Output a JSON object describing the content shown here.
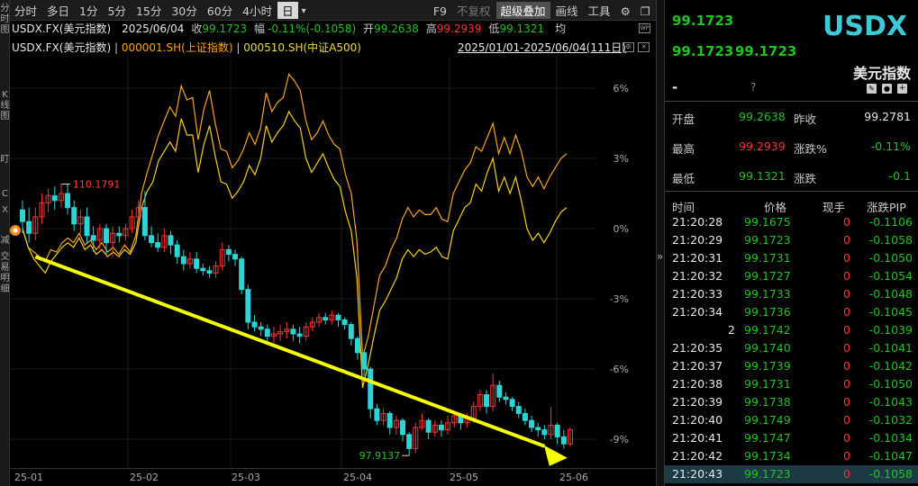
{
  "left_tabs": [
    "分时图",
    "K线图",
    "盯",
    "C",
    "X",
    "减",
    "交易明细"
  ],
  "toolbar": {
    "periods": [
      "分时",
      "多日",
      "1分",
      "5分",
      "15分",
      "30分",
      "60分",
      "4小时",
      "日"
    ],
    "active_period": "日",
    "dropdown_symbol": "▾",
    "f9": "F9",
    "no_rights": "不复权",
    "super_overlay": "超级叠加",
    "draw_line": "画线",
    "tools": "工具",
    "settings_icon": "gear-icon",
    "window_icons": [
      "restore-icon",
      "close-icon"
    ]
  },
  "info": {
    "symbol": "USDX.FX(美元指数)",
    "date": "2025/06/04",
    "close_label": "收",
    "close": "99.1723",
    "amp_label": "幅",
    "amp": "-0.11%(-0.1058)",
    "open_label": "开",
    "open": "99.2638",
    "high_label": "高",
    "high": "99.2939",
    "low_label": "低",
    "low": "99.1321",
    "avg_label": "均"
  },
  "legend": {
    "main": "USDX.FX(美元指数)",
    "sep": "|",
    "overlay1": "000001.SH(上证指数)",
    "overlay2": "000510.SH(中证A500)",
    "range": "2025/01/01-2025/06/04(111日)",
    "icons": [
      "settings-icon",
      "close-icon"
    ]
  },
  "chart_data": {
    "type": "candlestick",
    "y_axis_ticks": [
      "6%",
      "3%",
      "0%",
      "-3%",
      "-6%",
      "-9%"
    ],
    "y_axis_values": [
      6,
      3,
      0,
      -3,
      -6,
      -9
    ],
    "x_axis_ticks": [
      "25-01",
      "25-02",
      "25-03",
      "25-04",
      "25-05",
      "25-06"
    ],
    "annotations": {
      "high": "110.1791",
      "low": "97.9137"
    },
    "colors": {
      "up": "#ff3333",
      "down": "#2dd4d4",
      "overlay1": "#f5a623",
      "overlay2": "#f5d020",
      "arrow": "#f5ff00"
    },
    "candles": [
      [
        0.8,
        0.3,
        1.2,
        -0.2
      ],
      [
        0.3,
        -0.2,
        0.9,
        -0.6
      ],
      [
        -0.2,
        0.5,
        0.9,
        -0.5
      ],
      [
        0.5,
        1.1,
        1.5,
        0.2
      ],
      [
        1.1,
        1.4,
        1.7,
        0.7
      ],
      [
        1.4,
        1.2,
        1.8,
        0.8
      ],
      [
        1.2,
        1.5,
        1.9,
        0.9
      ],
      [
        1.5,
        0.9,
        1.9,
        0.6
      ],
      [
        0.9,
        0.2,
        1.2,
        -0.1
      ],
      [
        0.2,
        0.5,
        0.8,
        -0.2
      ],
      [
        0.5,
        -0.3,
        0.9,
        -0.6
      ],
      [
        -0.3,
        -0.5,
        0.1,
        -1.0
      ],
      [
        -0.5,
        0.0,
        0.2,
        -0.9
      ],
      [
        0.0,
        -0.6,
        0.2,
        -1.1
      ],
      [
        -0.6,
        -0.2,
        0.1,
        -1.2
      ],
      [
        -0.2,
        -0.3,
        0.1,
        -0.6
      ],
      [
        -0.3,
        0.0,
        0.2,
        -0.5
      ],
      [
        0.0,
        0.5,
        0.8,
        -0.2
      ],
      [
        0.5,
        0.9,
        1.2,
        0.3
      ],
      [
        0.9,
        -0.3,
        1.6,
        -0.5
      ],
      [
        -0.3,
        -0.6,
        0.1,
        -0.8
      ],
      [
        -0.6,
        -0.8,
        -0.2,
        -1.0
      ],
      [
        -0.8,
        -0.3,
        0.0,
        -1.0
      ],
      [
        -0.3,
        -0.7,
        -0.1,
        -1.1
      ],
      [
        -0.7,
        -1.2,
        -0.5,
        -1.5
      ],
      [
        -1.2,
        -1.5,
        -0.9,
        -1.8
      ],
      [
        -1.5,
        -1.3,
        -1.0,
        -1.7
      ],
      [
        -1.3,
        -1.7,
        -1.0,
        -1.9
      ],
      [
        -1.7,
        -1.8,
        -1.5,
        -2.0
      ],
      [
        -1.8,
        -1.9,
        -1.6,
        -2.1
      ],
      [
        -1.9,
        -1.6,
        -1.4,
        -2.1
      ],
      [
        -1.6,
        -0.9,
        -0.6,
        -1.8
      ],
      [
        -0.9,
        -1.1,
        -0.7,
        -1.4
      ],
      [
        -1.1,
        -1.3,
        -0.9,
        -1.6
      ],
      [
        -1.3,
        -2.6,
        -1.2,
        -2.8
      ],
      [
        -2.6,
        -4.0,
        -2.4,
        -4.3
      ],
      [
        -4.0,
        -4.2,
        -3.7,
        -4.4
      ],
      [
        -4.2,
        -4.3,
        -4.0,
        -4.6
      ],
      [
        -4.3,
        -4.6,
        -4.1,
        -4.8
      ],
      [
        -4.6,
        -4.5,
        -4.2,
        -4.9
      ],
      [
        -4.5,
        -4.4,
        -4.1,
        -4.8
      ],
      [
        -4.4,
        -4.3,
        -4.0,
        -4.7
      ],
      [
        -4.3,
        -4.5,
        -4.1,
        -4.8
      ],
      [
        -4.5,
        -4.6,
        -4.2,
        -4.9
      ],
      [
        -4.6,
        -4.2,
        -4.0,
        -4.8
      ],
      [
        -4.2,
        -4.0,
        -3.8,
        -4.4
      ],
      [
        -4.0,
        -3.8,
        -3.6,
        -4.2
      ],
      [
        -3.8,
        -3.9,
        -3.6,
        -4.1
      ],
      [
        -3.9,
        -3.7,
        -3.5,
        -4.1
      ],
      [
        -3.7,
        -3.9,
        -3.6,
        -4.2
      ],
      [
        -3.9,
        -4.1,
        -3.8,
        -4.3
      ],
      [
        -4.1,
        -4.7,
        -4.0,
        -5.0
      ],
      [
        -4.7,
        -5.3,
        -4.6,
        -5.6
      ],
      [
        -5.3,
        -6.0,
        -5.2,
        -6.3
      ],
      [
        -6.0,
        -7.7,
        -5.9,
        -8.1
      ],
      [
        -7.7,
        -8.2,
        -7.5,
        -8.4
      ],
      [
        -8.2,
        -7.9,
        -7.7,
        -8.4
      ],
      [
        -7.9,
        -8.5,
        -7.8,
        -8.8
      ],
      [
        -8.5,
        -8.2,
        -8.0,
        -8.8
      ],
      [
        -8.2,
        -8.8,
        -8.1,
        -9.1
      ],
      [
        -8.8,
        -9.4,
        -8.7,
        -9.7
      ],
      [
        -9.4,
        -8.5,
        -8.3,
        -9.6
      ],
      [
        -8.5,
        -8.2,
        -7.9,
        -8.6
      ],
      [
        -8.2,
        -8.7,
        -8.1,
        -9.0
      ],
      [
        -8.7,
        -8.4,
        -8.2,
        -8.9
      ],
      [
        -8.4,
        -8.6,
        -8.2,
        -8.9
      ],
      [
        -8.6,
        -8.3,
        -8.0,
        -8.8
      ],
      [
        -8.3,
        -8.0,
        -7.8,
        -8.5
      ],
      [
        -8.0,
        -8.3,
        -7.9,
        -8.6
      ],
      [
        -8.3,
        -8.1,
        -7.9,
        -8.5
      ],
      [
        -8.1,
        -7.6,
        -7.4,
        -8.3
      ],
      [
        -7.6,
        -7.1,
        -6.9,
        -7.8
      ],
      [
        -7.1,
        -7.6,
        -6.9,
        -7.9
      ],
      [
        -7.6,
        -6.7,
        -6.2,
        -7.8
      ],
      [
        -6.7,
        -7.2,
        -6.5,
        -7.4
      ],
      [
        -7.2,
        -7.3,
        -7.0,
        -7.5
      ],
      [
        -7.3,
        -7.6,
        -7.2,
        -7.8
      ],
      [
        -7.6,
        -7.9,
        -7.4,
        -8.1
      ],
      [
        -7.9,
        -8.2,
        -7.7,
        -8.4
      ],
      [
        -8.2,
        -8.5,
        -8.0,
        -8.7
      ],
      [
        -8.5,
        -8.6,
        -8.3,
        -8.9
      ],
      [
        -8.6,
        -8.8,
        -8.4,
        -9.0
      ],
      [
        -8.8,
        -8.4,
        -7.6,
        -9.0
      ],
      [
        -8.4,
        -8.9,
        -8.3,
        -9.2
      ],
      [
        -8.9,
        -9.2,
        -8.6,
        -9.4
      ],
      [
        -9.2,
        -8.6,
        -8.5,
        -9.3
      ]
    ],
    "overlay1_values": [
      0,
      -0.8,
      -1.0,
      -1.2,
      -1.4,
      -0.9,
      -1.0,
      -0.6,
      -0.4,
      -0.6,
      -0.2,
      -0.7,
      -0.5,
      -0.9,
      -0.6,
      -1.0,
      -0.8,
      -1.1,
      -0.7,
      -1.0,
      -0.3,
      1.5,
      2.4,
      3.2,
      4.0,
      4.6,
      5.2,
      4.8,
      6.1,
      5.5,
      5.6,
      3.8,
      5.1,
      5.9,
      4.5,
      3.4,
      3.3,
      2.6,
      2.9,
      3.4,
      4.1,
      3.6,
      4.3,
      5.8,
      5.0,
      5.4,
      5.6,
      6.6,
      6.3,
      5.9,
      4.6,
      3.8,
      4.1,
      4.6,
      4.0,
      3.6,
      3.4,
      2.3,
      1.5,
      -0.5,
      -5.5,
      -4.6,
      -3.3,
      -2.0,
      -1.6,
      -0.9,
      -0.4,
      0.4,
      0.9,
      0.5,
      0.8,
      0.6,
      0.6,
      0.9,
      0.4,
      0.3,
      1.5,
      2.0,
      2.5,
      2.8,
      3.5,
      3.3,
      3.9,
      4.5,
      3.2,
      3.9,
      3.2,
      4.0,
      3.3,
      2.2,
      1.8,
      2.2,
      1.7,
      2.2,
      2.6,
      3.0,
      3.2
    ],
    "overlay2_values": [
      0,
      -0.8,
      -1.3,
      -1.6,
      -1.9,
      -1.4,
      -1.1,
      -0.8,
      -0.6,
      -0.8,
      -0.4,
      -0.9,
      -0.7,
      -1.1,
      -0.9,
      -1.2,
      -1.0,
      -1.2,
      -0.9,
      -1.1,
      -0.6,
      0.9,
      1.6,
      2.0,
      2.9,
      3.3,
      3.7,
      3.3,
      4.7,
      4.0,
      4.0,
      2.4,
      3.6,
      4.4,
      3.1,
      2.0,
      1.9,
      1.3,
      1.6,
      2.0,
      2.7,
      2.3,
      3.0,
      4.4,
      3.7,
      4.1,
      4.4,
      5.0,
      4.6,
      4.3,
      3.0,
      2.4,
      2.8,
      3.2,
      2.6,
      2.1,
      1.8,
      0.7,
      -0.1,
      -2.1,
      -6.8,
      -5.8,
      -4.6,
      -3.5,
      -3.1,
      -2.6,
      -2.1,
      -1.3,
      -0.9,
      -1.2,
      -0.9,
      -1.1,
      -1.0,
      -0.8,
      -1.2,
      -1.3,
      -0.1,
      0.4,
      0.9,
      1.1,
      1.9,
      1.6,
      2.4,
      3.0,
      1.6,
      2.2,
      1.5,
      2.2,
      1.2,
      0.0,
      -0.5,
      -0.2,
      -0.6,
      -0.2,
      0.3,
      0.7,
      0.9
    ]
  },
  "right_panel": {
    "last_price": "99.1723",
    "ticker": "USDX",
    "bid": "99.1723",
    "ask": "99.1723",
    "name": "美元指数",
    "dash": "-",
    "question": "?",
    "icons": [
      "edit-icon",
      "bell-icon",
      "add-icon"
    ],
    "open_label": "开盘",
    "open": "99.2638",
    "prev_close_label": "昨收",
    "prev_close": "99.2781",
    "high_label": "最高",
    "high": "99.2939",
    "change_pct_label": "涨跌%",
    "change_pct": "-0.11%",
    "low_label": "最低",
    "low": "99.1321",
    "change_label": "涨跌",
    "change": "-0.1",
    "tick_headers": [
      "时间",
      "价格",
      "现手",
      "涨跌PIP"
    ],
    "ticks": [
      {
        "time": "21:20:28",
        "price": "99.1675",
        "vol": "0",
        "chg": "-0.1106"
      },
      {
        "time": "21:20:29",
        "price": "99.1723",
        "vol": "0",
        "chg": "-0.1058"
      },
      {
        "time": "21:20:31",
        "price": "99.1731",
        "vol": "0",
        "chg": "-0.1050"
      },
      {
        "time": "21:20:32",
        "price": "99.1727",
        "vol": "0",
        "chg": "-0.1054"
      },
      {
        "time": "21:20:33",
        "price": "99.1733",
        "vol": "0",
        "chg": "-0.1048"
      },
      {
        "time": "21:20:34",
        "price": "99.1736",
        "vol": "0",
        "chg": "-0.1045"
      },
      {
        "time": "2",
        "price": "99.1742",
        "vol": "0",
        "chg": "-0.1039"
      },
      {
        "time": "21:20:35",
        "price": "99.1740",
        "vol": "0",
        "chg": "-0.1041"
      },
      {
        "time": "21:20:37",
        "price": "99.1739",
        "vol": "0",
        "chg": "-0.1042"
      },
      {
        "time": "21:20:38",
        "price": "99.1731",
        "vol": "0",
        "chg": "-0.1050"
      },
      {
        "time": "21:20:39",
        "price": "99.1738",
        "vol": "0",
        "chg": "-0.1043"
      },
      {
        "time": "21:20:40",
        "price": "99.1749",
        "vol": "0",
        "chg": "-0.1032"
      },
      {
        "time": "21:20:41",
        "price": "99.1747",
        "vol": "0",
        "chg": "-0.1034"
      },
      {
        "time": "21:20:42",
        "price": "99.1734",
        "vol": "0",
        "chg": "-0.1047"
      },
      {
        "time": "21:20:43",
        "price": "99.1723",
        "vol": "0",
        "chg": "-0.1058"
      }
    ],
    "splitter_glyph": "»"
  }
}
